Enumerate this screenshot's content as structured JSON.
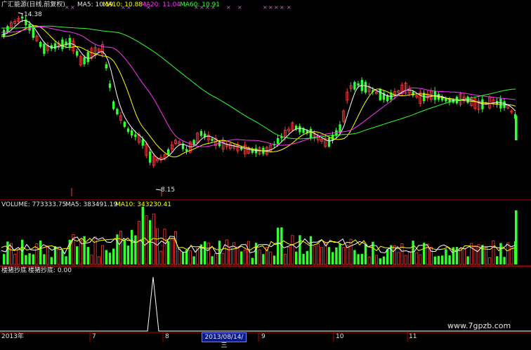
{
  "header": {
    "title": "广汇能源(日线,前复权)",
    "ma5": "MA5: 10.59",
    "ma10": "MA10: 10.88",
    "ma20": "MA20: 11.04",
    "ma60": "MA60: 10.91"
  },
  "price": {
    "high_label": "14.38",
    "low_label": "8.15"
  },
  "volume_header": {
    "volume": "VOLUME: 773333.75",
    "ma5": "MA5: 383491.19",
    "ma10": "MA10: 343230.41"
  },
  "indicator_header": {
    "name": "楼猪抄底",
    "value": "楼猪抄底: 0.00"
  },
  "x_axis": {
    "year": "2013年",
    "m7": "7",
    "m8": "8",
    "m9": "9",
    "m10": "10",
    "m11": "11",
    "cursor_date": "2013/08/14/三"
  },
  "watermark": "www.7gpzb.com",
  "colors": {
    "up": "#ff3b3b",
    "down": "#33ff33",
    "ma5": "#ffffff",
    "ma10": "#ffff00",
    "ma20": "#ff33ff",
    "ma60": "#33ff33",
    "axis": "#b00000"
  }
}
